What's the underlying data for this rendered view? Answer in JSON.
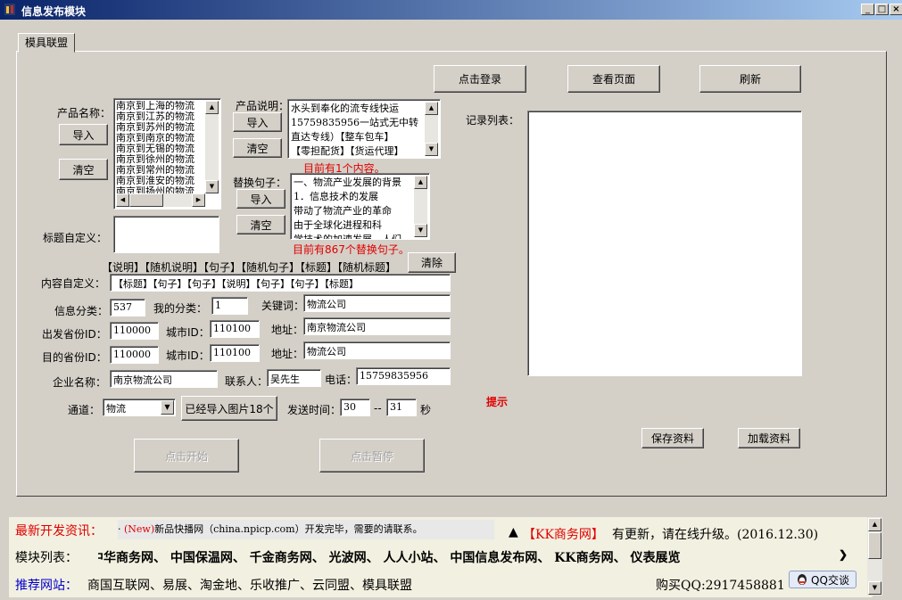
{
  "window": {
    "title": "信息发布模块",
    "min": "_",
    "max": "□",
    "close": "×"
  },
  "tab": {
    "label": "模具联盟"
  },
  "buttons": {
    "login": "点击登录",
    "view_page": "查看页面",
    "refresh": "刷新",
    "import_name": "导入",
    "clear_name": "清空",
    "import_desc": "导入",
    "clear_desc": "清空",
    "import_sent": "导入",
    "clear_sent": "清空",
    "clear_tags": "清除",
    "images": "已经导入图片18个",
    "start": "点击开始",
    "pause": "点击暂停",
    "save": "保存资料",
    "load": "加载资料"
  },
  "labels": {
    "product_name": "产品名称：",
    "product_desc": "产品说明：",
    "replace_sent": "替换句子：",
    "title_custom": "标题自定义：",
    "content_custom": "内容自定义：",
    "info_cat": "信息分类：",
    "my_cat": "我的分类：",
    "keyword": "关键词：",
    "from_prov": "出发省份ID：",
    "city_id1": "城市ID：",
    "addr1": "地址：",
    "to_prov": "目的省份ID：",
    "city_id2": "城市ID：",
    "addr2": "地址：",
    "company": "企业名称：",
    "contact": "联系人：",
    "phone": "电话：",
    "channel": "通道：",
    "send_time": "发送时间：",
    "dash": "--",
    "seconds": "秒",
    "records": "记录列表：",
    "hint": "提示"
  },
  "product_names": [
    "南京到上海的物流",
    "南京到江苏的物流",
    "南京到苏州的物流",
    "南京到南京的物流",
    "南京到无锡的物流",
    "南京到徐州的物流",
    "南京到常州的物流",
    "南京到淮安的物流",
    "南京到扬州的物流"
  ],
  "product_desc": [
    "水头到奉化的流专线快运",
    "15759835956一站式无中转",
    "直达专线）【整车包车】",
    "【零担配货】【货运代理】"
  ],
  "desc_count": "目前有1个内容。",
  "sentences": [
    "一、物流产业发展的背景",
    "    1．信息技术的发展",
    "带动了物流产业的革命",
    "    由于全球化进程和科",
    "学技术的加速发展，人们"
  ],
  "sent_count": "目前有867个替换句子。",
  "tags": "【说明】【随机说明】【句子】【随机句子】【标题】【随机标题】",
  "fields": {
    "content_custom": "【标题】【句子】【句子】【说明】【句子】【句子】【标题】",
    "info_cat": "537",
    "my_cat": "1",
    "keyword": "物流公司",
    "from_prov": "110000",
    "city1": "110100",
    "addr1": "南京物流公司",
    "to_prov": "110000",
    "city2": "110100",
    "addr2": "物流公司",
    "company": "南京物流公司",
    "contact": "吴先生",
    "phone": "15759835956",
    "channel": "物流",
    "time_from": "30",
    "time_to": "31"
  },
  "footer": {
    "news_label": "最新开发资讯：",
    "news_bullet": "·",
    "news_new": "(New)",
    "news_text": "新品快播网（china.npicp.com）开发完毕，需要的请联系。",
    "update_arrow": "▲",
    "update_brand": "【KK商务网】",
    "update_text": "有更新，请在线升级。(2016.12.30)",
    "modules_label": "模块列表：",
    "modules": "中华商务网、  中国保温网、  千金商务网、  光波网、  人人小站、  中国信息发布网、  KK商务网、  仪表展览",
    "rec_label": "推荐网站：",
    "rec_sites": "商国互联网、易展、淘金地、乐收推广、云同盟、模具联盟",
    "qq_label": "购买QQ:2917458881",
    "qq_button": "QQ交谈"
  },
  "colors": {
    "title_start": "#0a246a",
    "title_end": "#a6caf0",
    "red": "#e00000",
    "blue": "#0000cc",
    "face": "#d4d0c8"
  }
}
